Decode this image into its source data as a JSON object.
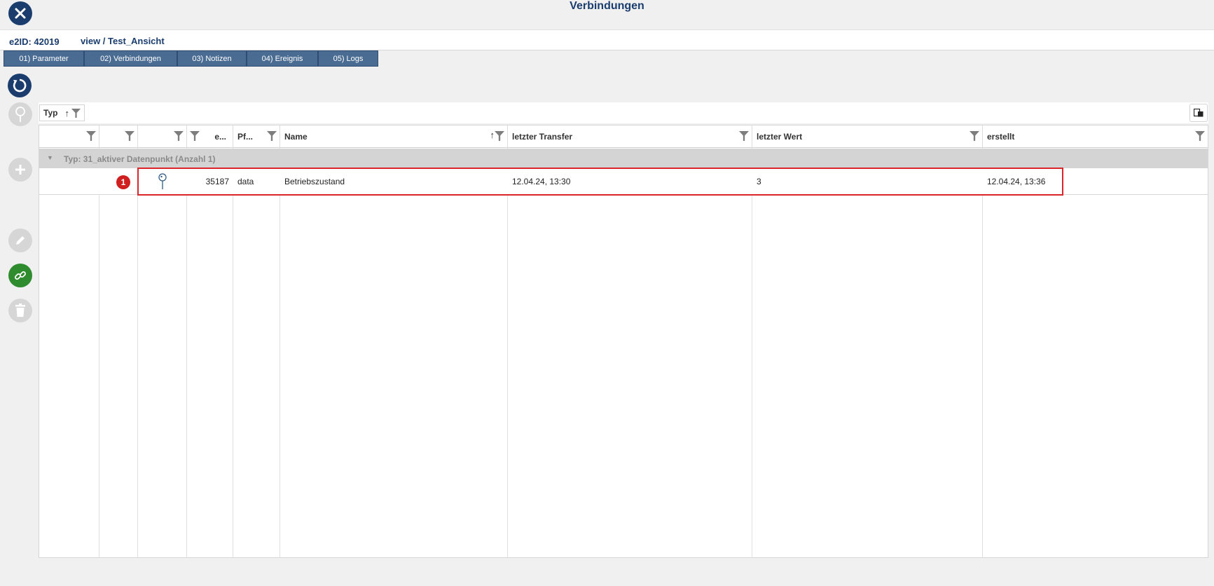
{
  "window": {
    "title": "Verbindungen"
  },
  "info": {
    "e2id": "e2ID: 42019",
    "view_path": "view / Test_Ansicht"
  },
  "tabs": [
    {
      "label": "01) Parameter"
    },
    {
      "label": "02) Verbindungen"
    },
    {
      "label": "03) Notizen"
    },
    {
      "label": "04) Ereignis"
    },
    {
      "label": "05) Logs"
    }
  ],
  "grouping": {
    "chip_label": "Typ"
  },
  "columns": [
    {
      "label": ""
    },
    {
      "label": ""
    },
    {
      "label": ""
    },
    {
      "label": "e..."
    },
    {
      "label": "Pf..."
    },
    {
      "label": "Name"
    },
    {
      "label": "letzter Transfer"
    },
    {
      "label": "letzter Wert"
    },
    {
      "label": "erstellt"
    }
  ],
  "group": {
    "label": "Typ: 31_aktiver Datenpunkt (Anzahl 1)"
  },
  "rows": [
    {
      "badge": "1",
      "id": "35187",
      "pfad": "data",
      "name": "Betriebszustand",
      "letzter_transfer": "12.04.24, 13:30",
      "letzter_wert": "3",
      "erstellt": "12.04.24, 13:36"
    }
  ],
  "colors": {
    "primary": "#1a3d6e",
    "tab": "#4a6c93",
    "link_active": "#2e8b2e",
    "disabled": "#d6d6d6",
    "highlight": "#d9262b",
    "badge": "#cf1f1f"
  },
  "icons": {
    "close": "close-icon",
    "refresh": "refresh-icon",
    "pin": "pin-icon",
    "add": "plus-icon",
    "edit": "pencil-icon",
    "link": "link-icon",
    "delete": "trash-icon",
    "filter": "filter-icon",
    "sort": "sort-ascending-icon",
    "settings": "column-settings-icon"
  }
}
